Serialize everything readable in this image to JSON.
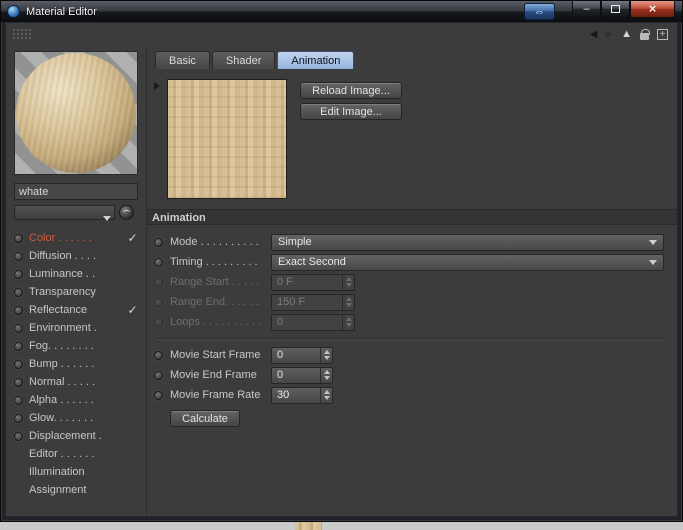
{
  "window": {
    "title": "Material Editor",
    "icons": {
      "nav": "⇔",
      "minimize": "–",
      "close": "×"
    }
  },
  "toolbar": {
    "icons": {
      "back": "◀",
      "forward": "▶",
      "up": "▲",
      "plus": "+"
    }
  },
  "left_panel": {
    "material_name": "whate",
    "channels": [
      {
        "label": "Color . . . . . .",
        "check": "✓"
      },
      {
        "label": "Diffusion . . . ."
      },
      {
        "label": "Luminance . ."
      },
      {
        "label": "Transparency"
      },
      {
        "label": "Reflectance",
        "check": "✓"
      },
      {
        "label": "Environment ."
      },
      {
        "label": "Fog. . . . . . . ."
      },
      {
        "label": "Bump . . . . . ."
      },
      {
        "label": "Normal . . . . ."
      },
      {
        "label": "Alpha . . . . . ."
      },
      {
        "label": "Glow. . . . . . ."
      },
      {
        "label": "Displacement ."
      },
      {
        "label": "Editor . . . . . ."
      },
      {
        "label": "Illumination"
      },
      {
        "label": "Assignment"
      }
    ]
  },
  "tabs": {
    "basic": "Basic",
    "shader": "Shader",
    "animation": "Animation"
  },
  "image_section": {
    "reload": "Reload Image...",
    "edit": "Edit Image..."
  },
  "animation": {
    "header": "Animation",
    "mode": {
      "label": "Mode . . . . . . . . . .",
      "value": "Simple"
    },
    "timing": {
      "label": "Timing . . . . . . . . .",
      "value": "Exact Second"
    },
    "range_start": {
      "label": "Range Start . . . . .",
      "value": "0 F"
    },
    "range_end": {
      "label": "Range End. . . . . .",
      "value": "150 F"
    },
    "loops": {
      "label": "Loops . . . . . . . . . .",
      "value": "0"
    },
    "movie_start": {
      "label": "Movie Start Frame",
      "value": "0"
    },
    "movie_end": {
      "label": "Movie End Frame",
      "value": "0"
    },
    "movie_rate": {
      "label": "Movie Frame Rate",
      "value": "30"
    },
    "calculate": "Calculate"
  }
}
